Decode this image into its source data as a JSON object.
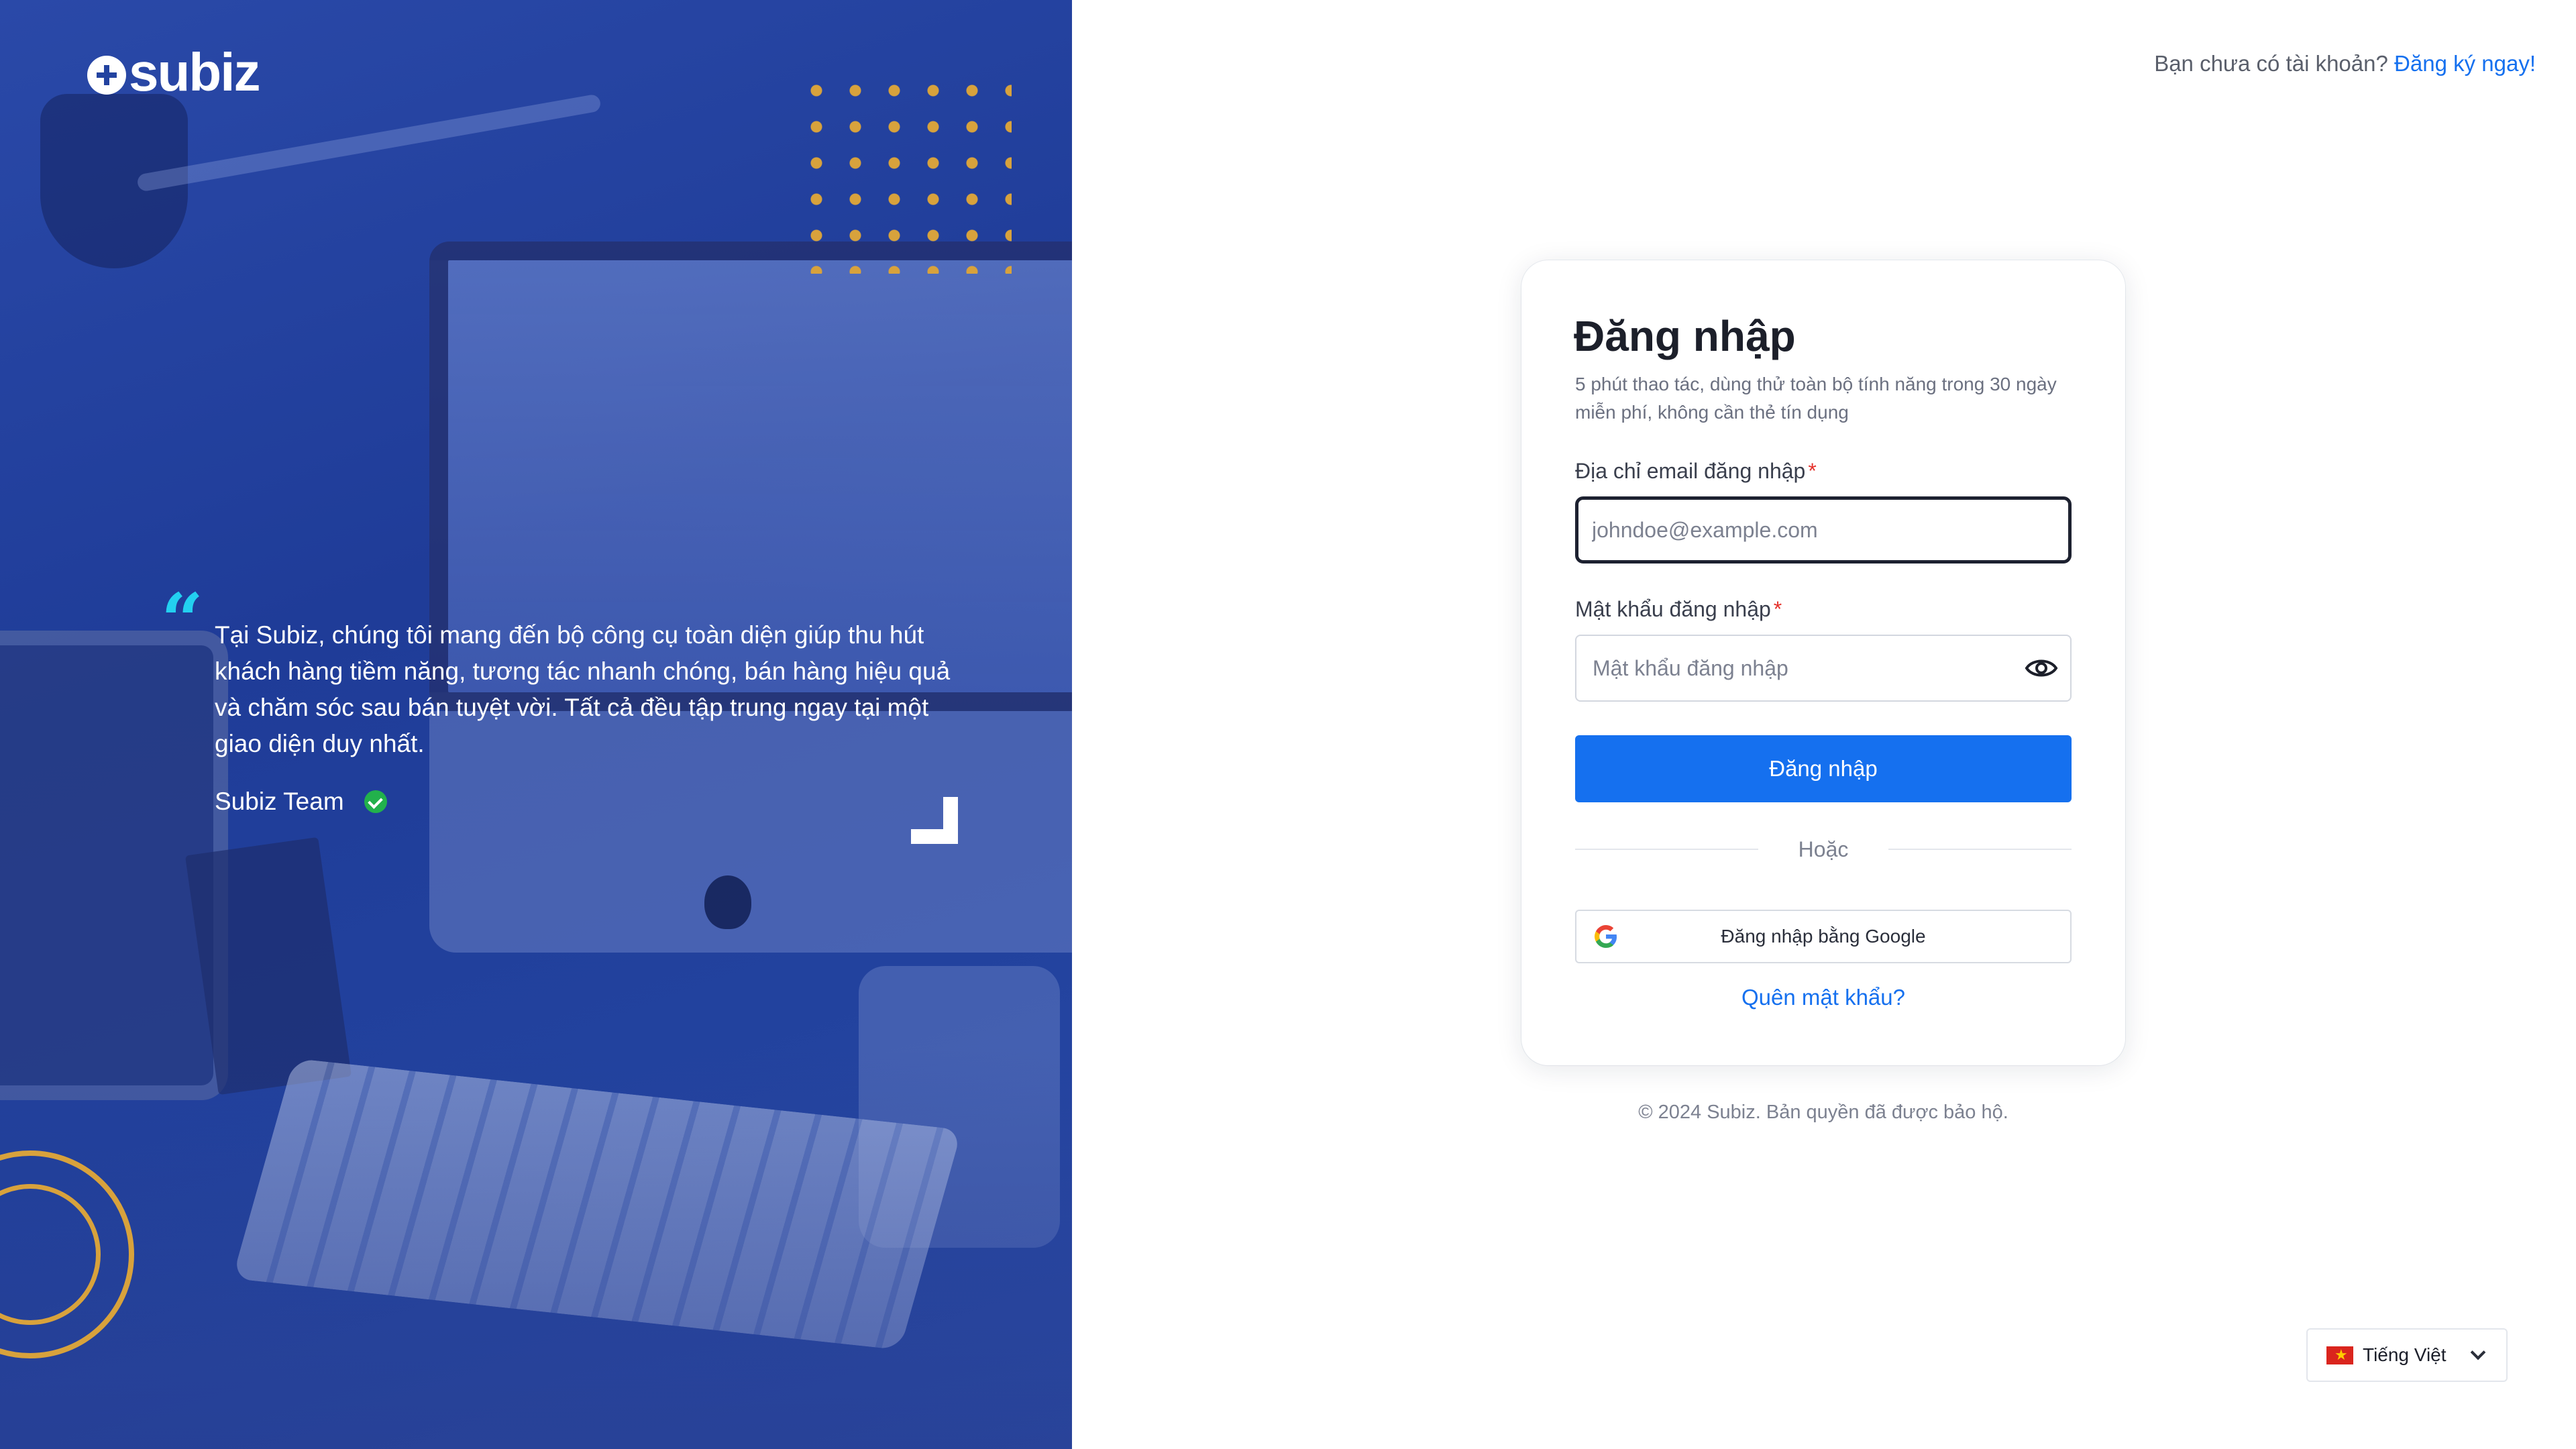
{
  "brand": {
    "name": "subiz"
  },
  "testimonial": {
    "quote_mark": "“",
    "text": "Tại Subiz, chúng tôi mang đến bộ công cụ toàn diện giúp thu hút khách hàng tiềm năng, tương tác nhanh chóng, bán hàng hiệu quả và chăm sóc sau bán tuyệt vời. Tất cả đều tập trung ngay tại một giao diện duy nhất.",
    "author": "Subiz Team"
  },
  "header": {
    "signup_prompt": "Bạn chưa có tài khoản?",
    "signup_link": "Đăng ký ngay!"
  },
  "login": {
    "title": "Đăng nhập",
    "subtitle": "5 phút thao tác, dùng thử toàn bộ tính năng trong 30 ngày miễn phí, không cần thẻ tín dụng",
    "email_label": "Địa chỉ email đăng nhập",
    "email_placeholder": "johndoe@example.com",
    "email_value": "",
    "password_label": "Mật khẩu đăng nhập",
    "password_placeholder": "Mật khẩu đăng nhập",
    "password_value": "",
    "required_mark": "*",
    "submit_label": "Đăng nhập",
    "divider_label": "Hoặc",
    "google_label": "Đăng nhập bằng Google",
    "forgot_label": "Quên mật khẩu?"
  },
  "footer": {
    "copyright": "© 2024 Subiz. Bản quyền đã được bảo hộ."
  },
  "language": {
    "selected": "Tiếng Việt",
    "flag": "vietnam-flag-icon"
  },
  "colors": {
    "primary": "#1570ef",
    "left_panel": "#2343a0",
    "accent_gold": "#d8a23c",
    "quote_cyan": "#23d0f0",
    "required": "#e5322c",
    "verified": "#22b14c"
  }
}
